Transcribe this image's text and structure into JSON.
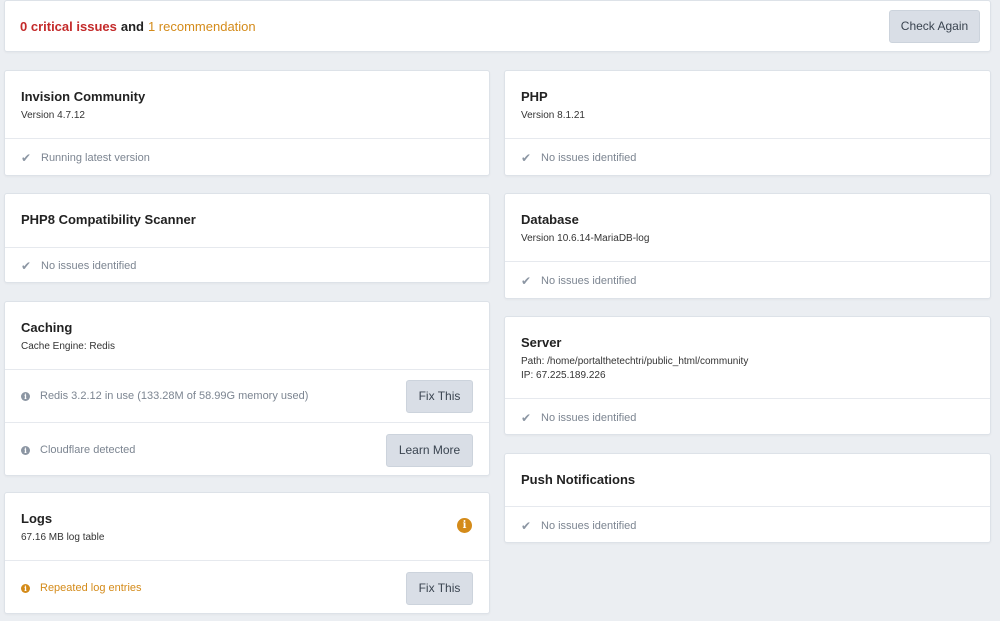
{
  "summary": {
    "critical": "0 critical issues",
    "and": "and",
    "recommendation": "1 recommendation",
    "check_again": "Check Again"
  },
  "cards": {
    "invision": {
      "title": "Invision Community",
      "sub": "Version 4.7.12",
      "status": "Running latest version"
    },
    "php8": {
      "title": "PHP8 Compatibility Scanner",
      "status": "No issues identified"
    },
    "caching": {
      "title": "Caching",
      "sub": "Cache Engine: Redis",
      "row1": "Redis 3.2.12 in use (133.28M of 58.99G memory used)",
      "row1_button": "Fix This",
      "row2": "Cloudflare detected",
      "row2_button": "Learn More"
    },
    "logs": {
      "title": "Logs",
      "sub": "67.16 MB log table",
      "status": "Repeated log entries",
      "button": "Fix This"
    },
    "php": {
      "title": "PHP",
      "sub": "Version 8.1.21",
      "status": "No issues identified"
    },
    "database": {
      "title": "Database",
      "sub": "Version 10.6.14-MariaDB-log",
      "status": "No issues identified"
    },
    "server": {
      "title": "Server",
      "path": "Path: /home/portalthetechtri/public_html/community",
      "ip": "IP: 67.225.189.226",
      "status": "No issues identified"
    },
    "push": {
      "title": "Push Notifications",
      "status": "No issues identified"
    }
  },
  "icons": {
    "check": "checkmark-icon",
    "info": "info-circle-icon"
  },
  "colors": {
    "critical": "#c42b2b",
    "warning": "#d48b1a",
    "muted": "#7c8591",
    "background": "#ebeef2"
  }
}
